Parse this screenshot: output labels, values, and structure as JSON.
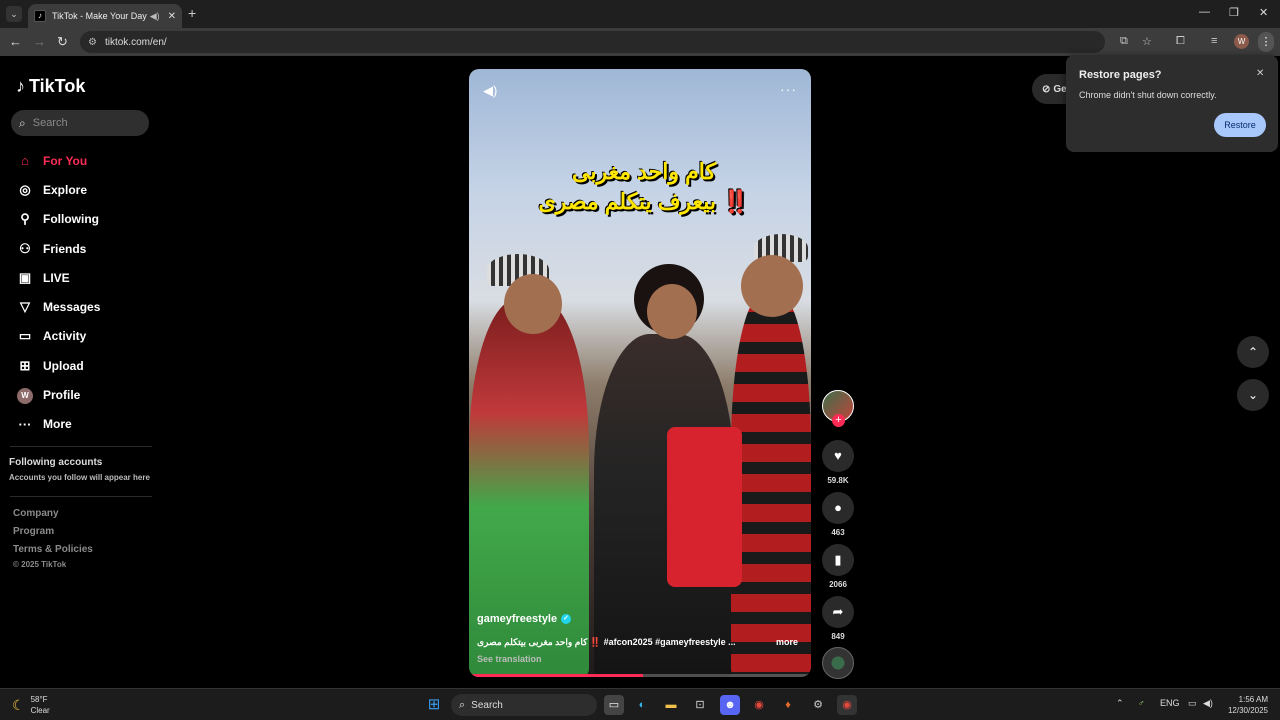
{
  "browser": {
    "tab_title": "TikTok - Make Your Day",
    "url": "tiktok.com/en/"
  },
  "sidebar": {
    "logo": "TikTok",
    "search_placeholder": "Search",
    "nav": [
      {
        "label": "For You",
        "icon": "home-icon"
      },
      {
        "label": "Explore",
        "icon": "compass-icon"
      },
      {
        "label": "Following",
        "icon": "person-icon"
      },
      {
        "label": "Friends",
        "icon": "friends-icon"
      },
      {
        "label": "LIVE",
        "icon": "live-icon"
      },
      {
        "label": "Messages",
        "icon": "send-icon"
      },
      {
        "label": "Activity",
        "icon": "inbox-icon"
      },
      {
        "label": "Upload",
        "icon": "plus-square-icon"
      },
      {
        "label": "Profile",
        "icon": "avatar",
        "initial": "W"
      },
      {
        "label": "More",
        "icon": "more-icon"
      }
    ],
    "following_title": "Following accounts",
    "following_sub": "Accounts you follow will appear here",
    "footer": [
      "Company",
      "Program",
      "Terms & Policies"
    ],
    "copyright": "© 2025 TikTok"
  },
  "video": {
    "caption_line1": "كام واحد مغربى",
    "caption_line2": "بيعرف يتكلم مصرى ‼️",
    "username": "gameyfreestyle",
    "description": "كام واحد مغربى بيتكلم مصرى ‼️ #afcon2025 #gameyfreestyle ...",
    "more": "more",
    "see_translation": "See translation",
    "progress": 0.51
  },
  "actions": {
    "likes": "59.8K",
    "comments": "463",
    "saves": "2066",
    "shares": "849"
  },
  "get_app": "Ge",
  "restore_popup": {
    "title": "Restore pages?",
    "message": "Chrome didn't shut down correctly.",
    "button": "Restore"
  },
  "taskbar": {
    "temp": "58°F",
    "condition": "Clear",
    "search": "Search",
    "lang": "ENG",
    "time": "1:56 AM",
    "date": "12/30/2025"
  }
}
